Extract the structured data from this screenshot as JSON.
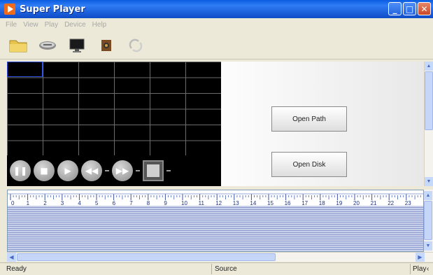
{
  "window": {
    "title": "Super Player",
    "buttons": {
      "minimize": "_",
      "maximize": "□",
      "close": "✕"
    }
  },
  "menu": {
    "items": [
      "File",
      "View",
      "Play",
      "Device",
      "Help"
    ]
  },
  "toolbar": {
    "icons": [
      "folder-icon",
      "hard-disk-icon",
      "monitor-icon",
      "camera-icon",
      "refresh-icon"
    ]
  },
  "controls": {
    "buttons": [
      "pause-icon",
      "stop-icon",
      "play-icon",
      "rewind-icon",
      "fast-forward-icon",
      "fullscreen-icon"
    ]
  },
  "right_panel": {
    "open_path_label": "Open Path",
    "open_disk_label": "Open Disk"
  },
  "timeline": {
    "hours": [
      "0",
      "1",
      "2",
      "3",
      "4",
      "5",
      "6",
      "7",
      "8",
      "9",
      "10",
      "11",
      "12",
      "13",
      "14",
      "15",
      "16",
      "17",
      "18",
      "19",
      "20",
      "21",
      "22",
      "23"
    ]
  },
  "status": {
    "ready": "Ready",
    "source": "Source",
    "play": "Play"
  },
  "colors": {
    "titlebar": "#0a5ce0",
    "video_bg": "#000000",
    "grid_line": "#6c6c6c",
    "track_line": "#8d9bd0"
  }
}
